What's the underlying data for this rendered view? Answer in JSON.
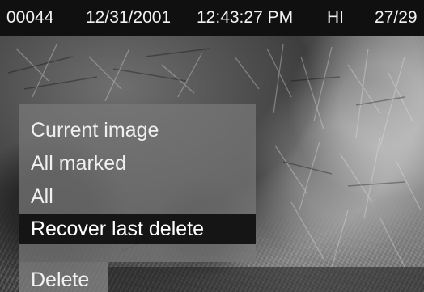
{
  "status_bar": {
    "frame_number": "00044",
    "date": "12/31/2001",
    "time": "12:43:27 PM",
    "quality": "HI",
    "image_count": "27/29"
  },
  "menu": {
    "items": [
      {
        "label": "Current image",
        "selected": false
      },
      {
        "label": "All marked",
        "selected": false
      },
      {
        "label": "All",
        "selected": false
      },
      {
        "label": "Recover last delete",
        "selected": true
      }
    ],
    "title_tab": "Delete"
  }
}
